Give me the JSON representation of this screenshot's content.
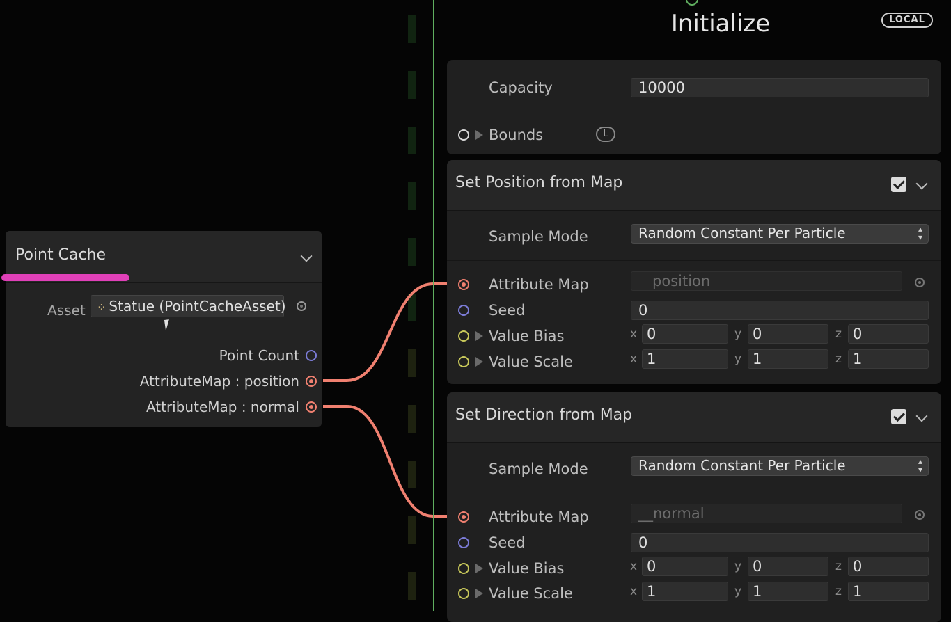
{
  "context": {
    "title": "Initialize",
    "badge": "LOCAL",
    "capacity_label": "Capacity",
    "capacity_value": "10000",
    "bounds_label": "Bounds",
    "bounds_badge": "L"
  },
  "blocks": [
    {
      "title": "Set Position from Map",
      "enabled": true,
      "sample_mode_label": "Sample Mode",
      "sample_mode_value": "Random Constant Per Particle",
      "attribute_map_label": "Attribute Map",
      "attribute_map_value": "position",
      "seed_label": "Seed",
      "seed_value": "0",
      "value_bias_label": "Value Bias",
      "value_bias": {
        "x": "0",
        "y": "0",
        "z": "0"
      },
      "value_scale_label": "Value Scale",
      "value_scale": {
        "x": "1",
        "y": "1",
        "z": "1"
      }
    },
    {
      "title": "Set Direction from Map",
      "enabled": true,
      "sample_mode_label": "Sample Mode",
      "sample_mode_value": "Random Constant Per Particle",
      "attribute_map_label": "Attribute Map",
      "attribute_map_value": "__normal",
      "seed_label": "Seed",
      "seed_value": "0",
      "value_bias_label": "Value Bias",
      "value_bias": {
        "x": "0",
        "y": "0",
        "z": "0"
      },
      "value_scale_label": "Value Scale",
      "value_scale": {
        "x": "1",
        "y": "1",
        "z": "1"
      }
    }
  ],
  "axis_labels": {
    "x": "x",
    "y": "y",
    "z": "z"
  },
  "point_cache": {
    "title": "Point Cache",
    "asset_label": "Asset",
    "asset_value": "Statue (PointCacheAsset)",
    "outputs": [
      "Point Count",
      "AttributeMap : position",
      "AttributeMap : normal"
    ]
  },
  "colors": {
    "context_line": "#5fae5f",
    "edge": "#f08070",
    "highlight": "#e040b8",
    "port_blue": "#7c7cd8",
    "port_yellow": "#c8c85a"
  }
}
